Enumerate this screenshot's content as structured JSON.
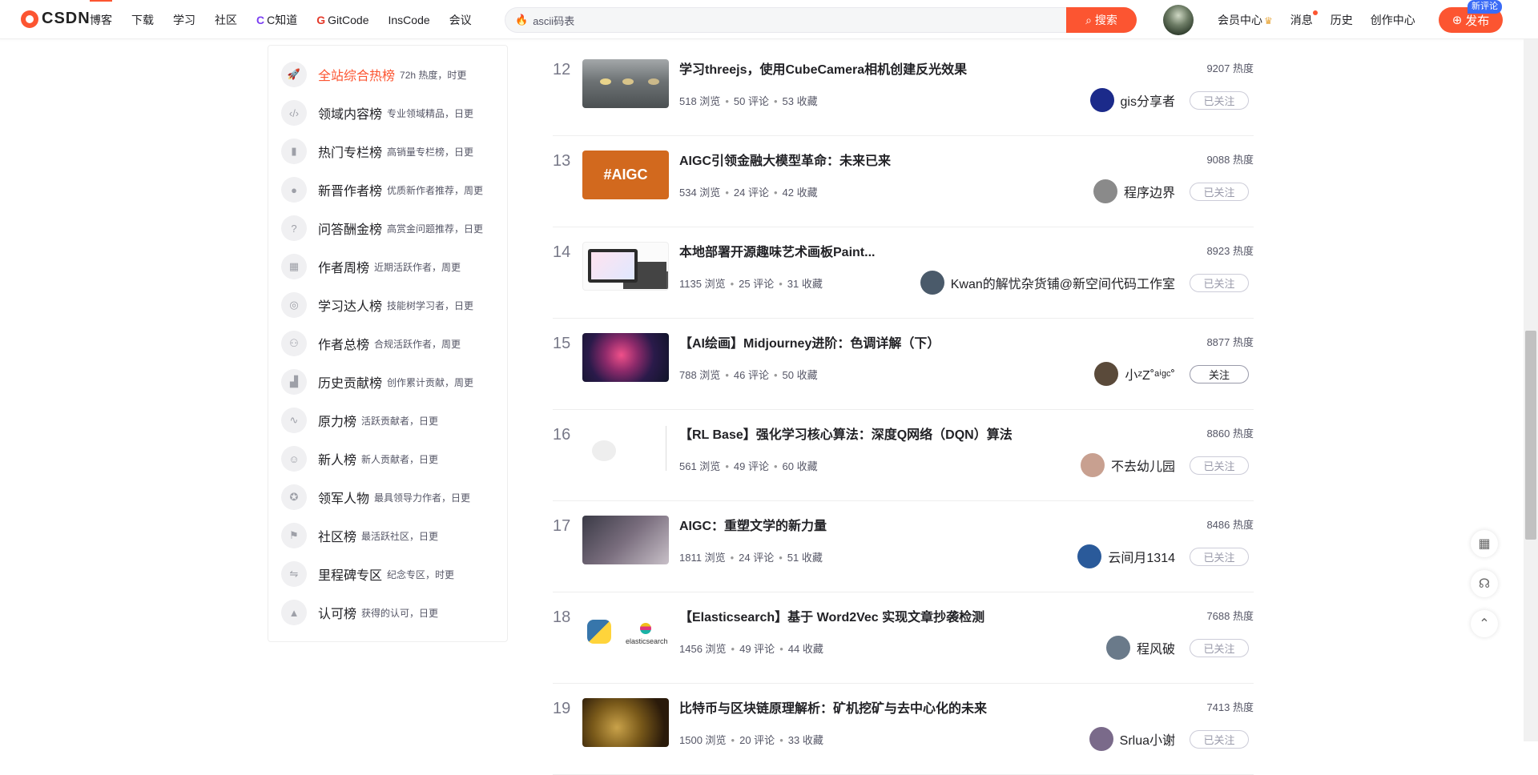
{
  "header": {
    "logo_text": "CSDN",
    "nav": [
      {
        "label": "博客",
        "active": true
      },
      {
        "label": "下载"
      },
      {
        "label": "学习"
      },
      {
        "label": "社区"
      },
      {
        "label": "C知道",
        "icon": "C"
      },
      {
        "label": "GitCode",
        "icon": "G"
      },
      {
        "label": "InsCode"
      },
      {
        "label": "会议"
      }
    ],
    "search": {
      "value": "ascii码表",
      "button": "搜索"
    },
    "right": [
      {
        "label": "会员中心"
      },
      {
        "label": "消息"
      },
      {
        "label": "历史"
      },
      {
        "label": "创作中心"
      }
    ],
    "publish": {
      "label": "发布",
      "badge": "新评论"
    }
  },
  "sidebar": {
    "items": [
      {
        "title": "全站综合热榜",
        "desc": "72h 热度，时更",
        "icon": "rocket-icon",
        "active": true
      },
      {
        "title": "领域内容榜",
        "desc": "专业领域精品，日更",
        "icon": "code-icon"
      },
      {
        "title": "热门专栏榜",
        "desc": "高销量专栏榜，日更",
        "icon": "book-icon"
      },
      {
        "title": "新晋作者榜",
        "desc": "优质新作者推荐，周更",
        "icon": "user-icon"
      },
      {
        "title": "问答酬金榜",
        "desc": "高赏金问题推荐，日更",
        "icon": "question-icon"
      },
      {
        "title": "作者周榜",
        "desc": "近期活跃作者，周更",
        "icon": "calendar-icon"
      },
      {
        "title": "学习达人榜",
        "desc": "技能树学习者，日更",
        "icon": "medal-icon"
      },
      {
        "title": "作者总榜",
        "desc": "合规活跃作者，周更",
        "icon": "group-icon"
      },
      {
        "title": "历史贡献榜",
        "desc": "创作累计贡献，周更",
        "icon": "stairs-icon"
      },
      {
        "title": "原力榜",
        "desc": "活跃贡献者，日更",
        "icon": "wave-icon"
      },
      {
        "title": "新人榜",
        "desc": "新人贡献者，日更",
        "icon": "newbie-icon"
      },
      {
        "title": "领军人物",
        "desc": "最具领导力作者，日更",
        "icon": "leader-icon"
      },
      {
        "title": "社区榜",
        "desc": "最活跃社区，日更",
        "icon": "flag-icon"
      },
      {
        "title": "里程碑专区",
        "desc": "纪念专区，时更",
        "icon": "milestone-icon"
      },
      {
        "title": "认可榜",
        "desc": "获得的认可，日更",
        "icon": "badge-icon"
      }
    ]
  },
  "articles": [
    {
      "rank": "12",
      "title": "学习threejs，使用CubeCamera相机创建反光效果",
      "views": "518 浏览",
      "comments": "50 评论",
      "favs": "53 收藏",
      "heat": "9207 热度",
      "author": "gis分享者",
      "follow": "已关注",
      "avatar_color": "#1b2a8a"
    },
    {
      "rank": "13",
      "title": "AIGC引领金融大模型革命：未来已来",
      "views": "534 浏览",
      "comments": "24 评论",
      "favs": "42 收藏",
      "heat": "9088 热度",
      "author": "程序边界",
      "follow": "已关注",
      "avatar_color": "#8a8a8a",
      "thumb_text": "#AIGC"
    },
    {
      "rank": "14",
      "title": "本地部署开源趣味艺术画板Paint...",
      "views": "1135 浏览",
      "comments": "25 评论",
      "favs": "31 收藏",
      "heat": "8923 热度",
      "author": "Kwan的解忧杂货铺@新空间代码工作室",
      "follow": "已关注",
      "avatar_color": "#4a5a6a"
    },
    {
      "rank": "15",
      "title": "【AI绘画】Midjourney进阶：色调详解（下）",
      "views": "788 浏览",
      "comments": "46 评论",
      "favs": "50 收藏",
      "heat": "8877 热度",
      "author": "小ᶻZ˚ᵃⁱᵍᶜ˚",
      "follow": "关注",
      "follow_active": true,
      "avatar_color": "#5a4a3a"
    },
    {
      "rank": "16",
      "title": "【RL Base】强化学习核心算法：深度Q网络（DQN）算法",
      "views": "561 浏览",
      "comments": "49 评论",
      "favs": "60 收藏",
      "heat": "8860 热度",
      "author": "不去幼儿园",
      "follow": "已关注",
      "avatar_color": "#c8a090"
    },
    {
      "rank": "17",
      "title": "AIGC：重塑文学的新力量",
      "views": "1811 浏览",
      "comments": "24 评论",
      "favs": "51 收藏",
      "heat": "8486 热度",
      "author": "云间月1314",
      "follow": "已关注",
      "avatar_color": "#2a5a9a"
    },
    {
      "rank": "18",
      "title": "【Elasticsearch】基于 Word2Vec 实现文章抄袭检测",
      "views": "1456 浏览",
      "comments": "49 评论",
      "favs": "44 收藏",
      "heat": "7688 热度",
      "author": "程风破",
      "follow": "已关注",
      "avatar_color": "#6a7a8a",
      "thumb_text": "elasticsearch"
    },
    {
      "rank": "19",
      "title": "比特币与区块链原理解析：矿机挖矿与去中心化的未来",
      "views": "1500 浏览",
      "comments": "20 评论",
      "favs": "33 收藏",
      "heat": "7413 热度",
      "author": "Srlua小谢",
      "follow": "已关注",
      "avatar_color": "#7a6a8a"
    }
  ]
}
